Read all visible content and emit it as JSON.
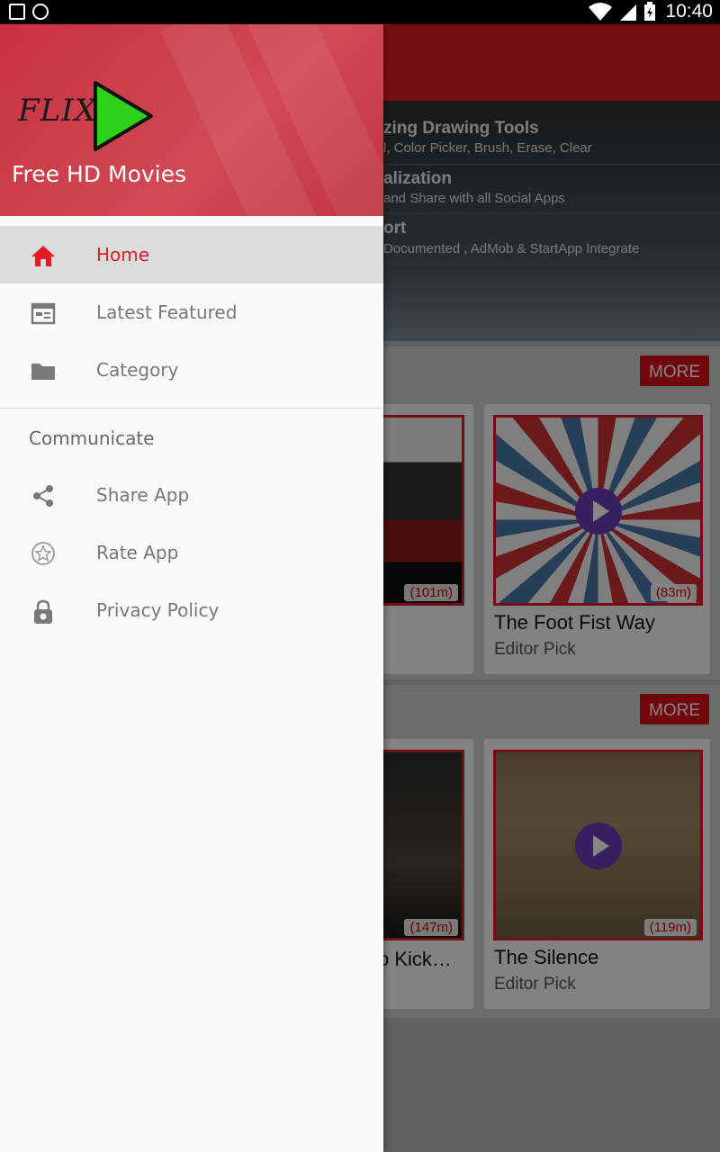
{
  "status_bar": {
    "time": "10:40",
    "left_icons": [
      "image-icon",
      "shield-icon"
    ],
    "right_icons": [
      "wifi-icon",
      "signal-icon",
      "battery-charging-icon"
    ]
  },
  "drawer": {
    "logo_text": "FLIX",
    "app_title": "Free HD Movies",
    "items": [
      {
        "label": "Home",
        "icon": "home-icon",
        "active": true
      },
      {
        "label": "Latest Featured",
        "icon": "calendar-icon",
        "active": false
      },
      {
        "label": "Category",
        "icon": "folder-icon",
        "active": false
      }
    ],
    "group_label": "Communicate",
    "communicate_items": [
      {
        "label": "Share App",
        "icon": "share-icon"
      },
      {
        "label": "Rate App",
        "icon": "star-icon"
      },
      {
        "label": "Privacy Policy",
        "icon": "lock-icon"
      }
    ]
  },
  "background": {
    "banner_lines": [
      {
        "title": "zing Drawing Tools",
        "subtitle": "l, Color Picker, Brush, Erase, Clear"
      },
      {
        "title": "alization",
        "subtitle": "and Share with all Social Apps"
      },
      {
        "title": "ort",
        "subtitle": "Documented , AdMob & StartApp Integrate"
      }
    ],
    "sections": [
      {
        "more_label": "MORE",
        "cards": [
          {
            "title": "",
            "subtitle": "",
            "duration": "(101m)"
          },
          {
            "title": "The Foot Fist Way",
            "subtitle": "Editor Pick",
            "duration": "(83m)"
          }
        ]
      },
      {
        "more_label": "MORE",
        "cards": [
          {
            "title": "o Kick…",
            "subtitle": "",
            "duration": "(147m)"
          },
          {
            "title": "The Silence",
            "subtitle": "Editor Pick",
            "duration": "(119m)"
          }
        ]
      }
    ]
  },
  "colors": {
    "accent": "#e11c24",
    "drawer_header": "#c8323f",
    "play_button": "#6a3fb8"
  }
}
